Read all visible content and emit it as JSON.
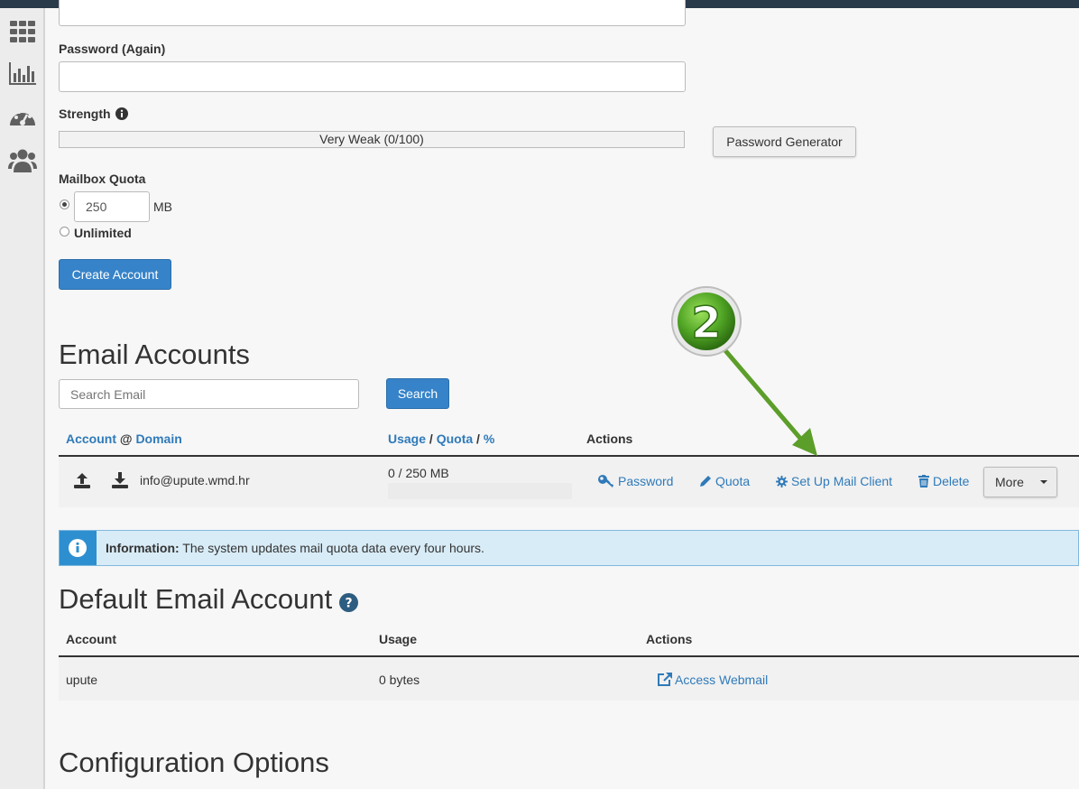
{
  "form": {
    "password_again_label": "Password (Again)",
    "strength_label": "Strength",
    "strength_text": "Very Weak (0/100)",
    "strength_value": 0,
    "password_generator_label": "Password Generator",
    "mailbox_quota_label": "Mailbox Quota",
    "quota_value": "250",
    "quota_unit": "MB",
    "unlimited_label": "Unlimited",
    "create_account_label": "Create Account"
  },
  "email_accounts": {
    "title": "Email Accounts",
    "search_placeholder": "Search Email",
    "search_button": "Search",
    "headers": {
      "account": "Account",
      "at": "@",
      "domain": "Domain",
      "usage": "Usage",
      "slash": "/",
      "quota": "Quota",
      "percent": "%",
      "actions": "Actions"
    },
    "rows": [
      {
        "email": "info@upute.wmd.hr",
        "usage": "0 / 250 MB",
        "usage_fraction": 0,
        "actions": {
          "password": "Password",
          "quota": "Quota",
          "setup": "Set Up Mail Client",
          "delete": "Delete",
          "more": "More"
        }
      }
    ]
  },
  "info": {
    "title": "Information:",
    "text": "The system updates mail quota data every four hours."
  },
  "default_account": {
    "title": "Default Email Account",
    "headers": {
      "account": "Account",
      "usage": "Usage",
      "actions": "Actions"
    },
    "row": {
      "account": "upute",
      "usage": "0 bytes",
      "action": "Access Webmail"
    }
  },
  "config": {
    "title": "Configuration Options"
  },
  "annotation": {
    "step": "2"
  },
  "colors": {
    "topbar": "#293a4a",
    "primary": "#3683c9",
    "link": "#2f7ab9",
    "info_bg": "#d8ecf7",
    "arrow": "#5c9e2a"
  }
}
